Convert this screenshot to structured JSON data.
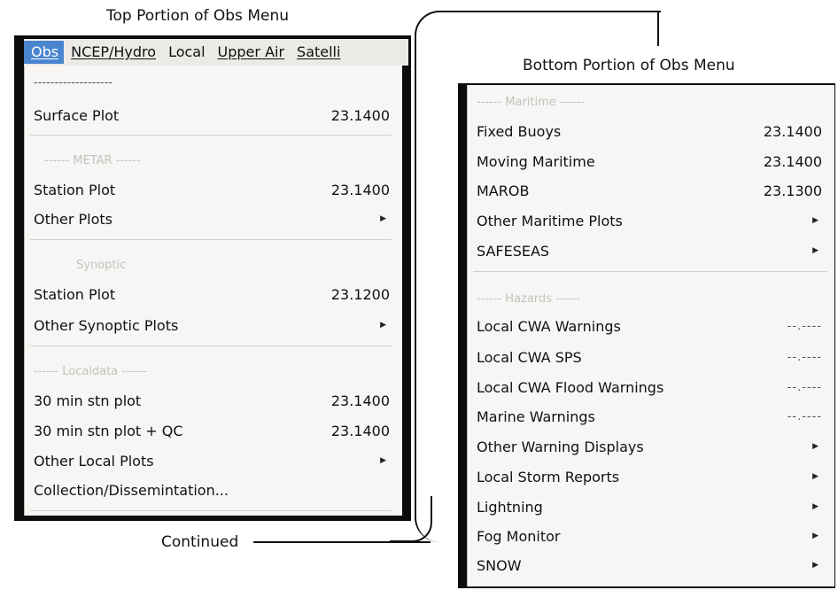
{
  "captions": {
    "top": "Top Portion of Obs Menu",
    "bottom": "Bottom Portion of Obs Menu",
    "continued": "Continued"
  },
  "menubar": {
    "items": [
      "Obs",
      "NCEP/Hydro",
      "Local",
      "Upper Air",
      "Satelli"
    ]
  },
  "top_menu": {
    "dashes": "-------------------",
    "surface_plot": {
      "label": "Surface Plot",
      "value": "23.1400"
    },
    "metar_header": "------ METAR ------",
    "station_plot_metar": {
      "label": "Station Plot",
      "value": "23.1400"
    },
    "other_plots": {
      "label": "Other Plots"
    },
    "synoptic_header": "Synoptic",
    "station_plot_synoptic": {
      "label": "Station Plot",
      "value": "23.1200"
    },
    "other_synoptic_plots": {
      "label": "Other Synoptic Plots"
    },
    "localdata_header": "------ Localdata ------",
    "stn_plot_30": {
      "label": "30 min stn plot",
      "value": "23.1400"
    },
    "stn_plot_30_qc": {
      "label": "30 min stn plot + QC",
      "value": "23.1400"
    },
    "other_local_plots": {
      "label": "Other Local Plots"
    },
    "collection": {
      "label": "Collection/Dissemintation..."
    }
  },
  "bottom_menu": {
    "maritime_header": "------ Maritime ------",
    "fixed_buoys": {
      "label": "Fixed Buoys",
      "value": "23.1400"
    },
    "moving_maritime": {
      "label": "Moving Maritime",
      "value": "23.1400"
    },
    "marob": {
      "label": "MAROB",
      "value": "23.1300"
    },
    "other_maritime_plots": {
      "label": "Other Maritime Plots"
    },
    "safeseas": {
      "label": "SAFESEAS"
    },
    "hazards_header": "------ Hazards ------",
    "local_cwa_warnings": {
      "label": "Local CWA Warnings",
      "value": "--.----"
    },
    "local_cwa_sps": {
      "label": "Local CWA SPS",
      "value": "--.----"
    },
    "local_cwa_flood": {
      "label": "Local CWA Flood Warnings",
      "value": "--.----"
    },
    "marine_warnings": {
      "label": "Marine Warnings",
      "value": "--.----"
    },
    "other_warning_displays": {
      "label": "Other Warning Displays"
    },
    "local_storm_reports": {
      "label": "Local Storm Reports"
    },
    "lightning": {
      "label": "Lightning"
    },
    "fog_monitor": {
      "label": "Fog Monitor"
    },
    "snow": {
      "label": "SNOW"
    }
  }
}
